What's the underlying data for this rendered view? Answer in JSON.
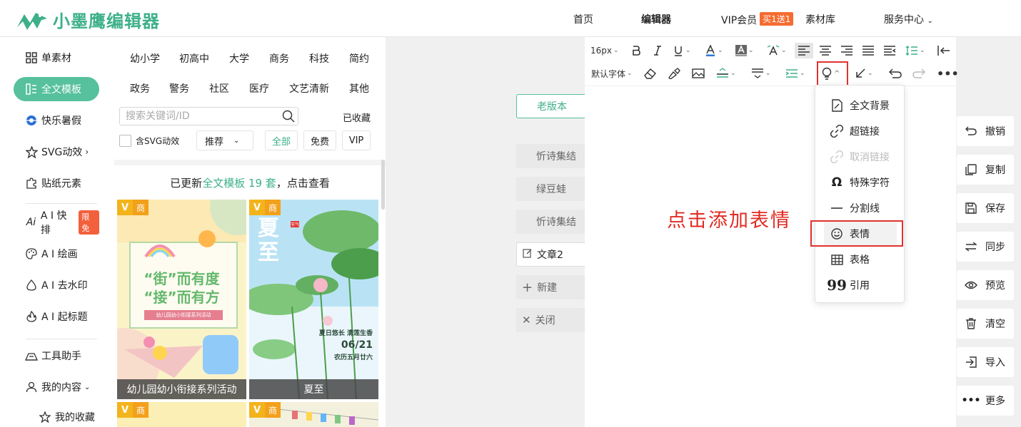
{
  "brand": {
    "name": "小墨鹰编辑器",
    "color": "#3db08a"
  },
  "nav": {
    "home": "首页",
    "editor": "编辑器",
    "vip": "VIP会员",
    "vip_badge": "买1送1",
    "library": "素材库",
    "service": "服务中心"
  },
  "sidebar": {
    "items": [
      {
        "label": "单素材",
        "icon": "grid-icon"
      },
      {
        "label": "全文模板",
        "icon": "template-icon",
        "active": true
      },
      {
        "label": "快乐暑假",
        "icon": "ball-icon"
      },
      {
        "label": "SVG动效",
        "icon": "star-icon"
      },
      {
        "label": "贴纸元素",
        "icon": "puzzle-icon"
      },
      {
        "label": "A I 快排",
        "icon": "ai-icon",
        "badge": "限免"
      },
      {
        "label": "A I 绘画",
        "icon": "palette-icon"
      },
      {
        "label": "A I 去水印",
        "icon": "drop-icon"
      },
      {
        "label": "A I 起标题",
        "icon": "flame-icon"
      },
      {
        "label": "工具助手",
        "icon": "tool-icon"
      },
      {
        "label": "我的内容",
        "icon": "user-icon"
      },
      {
        "label": "我的收藏",
        "icon": "star-outline-icon"
      }
    ]
  },
  "templates": {
    "categories_row1": [
      "幼小学",
      "初高中",
      "大学",
      "商务",
      "科技",
      "简约"
    ],
    "categories_row2": [
      "政务",
      "警务",
      "社区",
      "医疗",
      "文艺清新",
      "其他"
    ],
    "search_placeholder": "搜索关键词/ID",
    "collected": "已收藏",
    "svg_checkbox": "含SVG动效",
    "sort_select": "推荐",
    "filters": [
      "全部",
      "免费",
      "VIP"
    ],
    "updated_prefix": "已更新",
    "updated_highlight": "全文模板 19 套",
    "updated_suffix": "，点击查看",
    "cards": [
      {
        "title": "幼儿园幼小衔接系列活动",
        "corner": "商",
        "poster_line1": "“街”而有度",
        "poster_line2": "“接”而有方",
        "poster_sub": "幼儿园幼小衔接系列活动"
      },
      {
        "title": "夏至",
        "corner": "商",
        "poster_big": "夏至",
        "poster_tag": "节气",
        "poster_line1": "夏日悠长 清莲生香",
        "poster_date": "06/21",
        "poster_lunar": "农历五月廿六"
      }
    ]
  },
  "articles": {
    "old_version": "老版本",
    "items": [
      "忻诗集结",
      "绿豆蛙",
      "忻诗集结"
    ],
    "current": "文章2",
    "new": "新建",
    "close": "关闭"
  },
  "toolbar": {
    "font_size": "16px",
    "font_family": "默认字体"
  },
  "hint": "点击添加表情",
  "insert_menu": {
    "items": [
      {
        "label": "全文背景",
        "icon": "background-icon"
      },
      {
        "label": "超链接",
        "icon": "link-icon"
      },
      {
        "label": "取消链接",
        "icon": "unlink-icon",
        "disabled": true
      },
      {
        "label": "特殊字符",
        "icon": "omega-icon"
      },
      {
        "label": "分割线",
        "icon": "divider-icon"
      },
      {
        "label": "表情",
        "icon": "emoji-icon",
        "hover": true
      },
      {
        "label": "表格",
        "icon": "table-icon"
      },
      {
        "label": "引用",
        "icon": "quote-icon"
      }
    ]
  },
  "actions": [
    "撤销",
    "复制",
    "保存",
    "同步",
    "预览",
    "清空",
    "导入",
    "更多"
  ],
  "colors": {
    "accent": "#56c19c",
    "highlight_red": "#e0322e",
    "vip_orange": "#f56c2f"
  }
}
